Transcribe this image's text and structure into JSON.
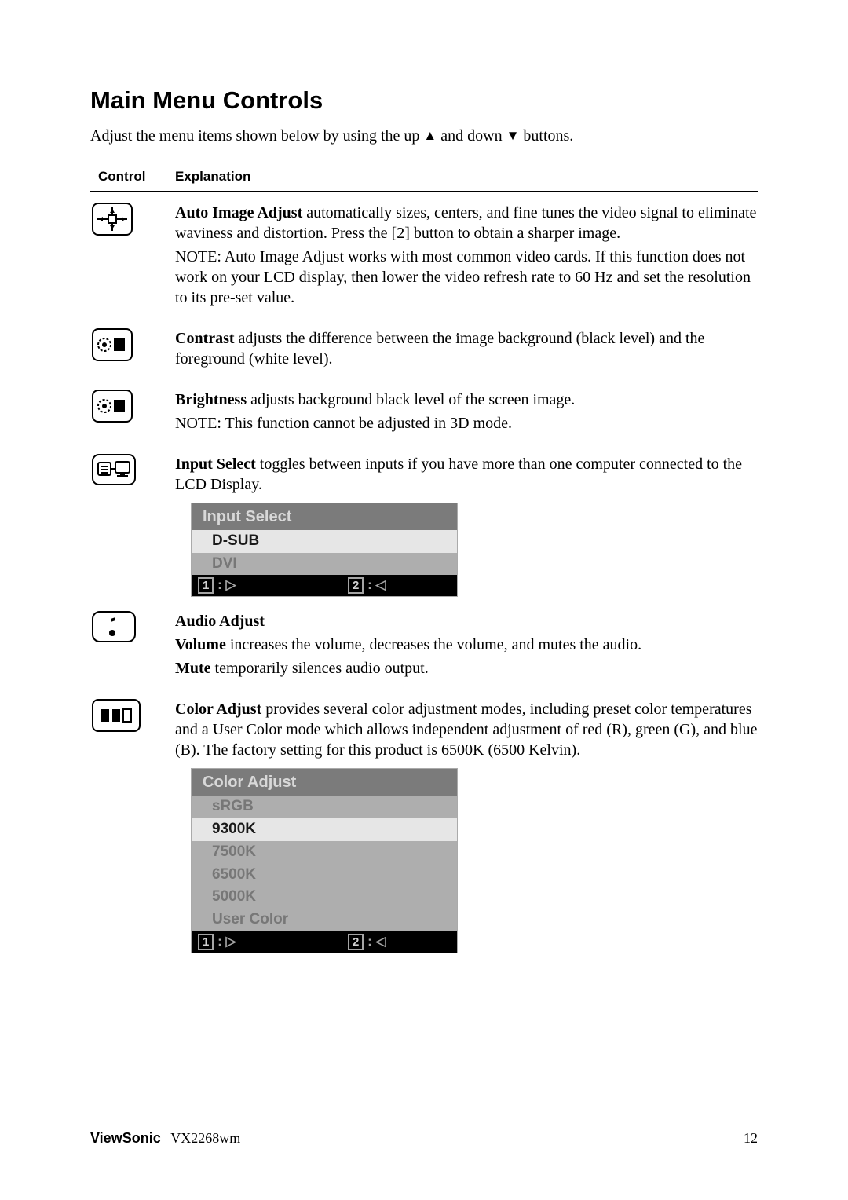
{
  "title": "Main Menu Controls",
  "intro_prefix": "Adjust the menu items shown below by using the up ",
  "intro_mid": " and down ",
  "intro_suffix": " buttons.",
  "table": {
    "col1": "Control",
    "col2": "Explanation"
  },
  "rows": {
    "auto_image": {
      "lead": "Auto Image Adjust",
      "body": " automatically sizes, centers, and fine tunes the video signal to eliminate waviness and distortion. Press the [2] button to obtain a sharper image.",
      "note_label": "NOTE:",
      "note": " Auto Image Adjust works with most common video cards. If this function does not work on your LCD display, then lower the video refresh rate to 60 Hz and set the resolution to its pre-set value."
    },
    "contrast": {
      "lead": "Contrast",
      "body": " adjusts the difference between the image background  (black level) and the foreground (white level)."
    },
    "brightness": {
      "lead": "Brightness",
      "body": " adjusts background black level of the screen image.",
      "note_label": "NOTE:",
      "note": " This function cannot be adjusted in 3D mode."
    },
    "input_select": {
      "lead": "Input Select",
      "body": " toggles between inputs if you have more than one computer connected to the LCD Display."
    },
    "audio": {
      "lead": "Audio Adjust",
      "vol_lead": "Volume",
      "vol_body": " increases the volume, decreases the volume, and mutes the audio.",
      "mute_lead": "Mute",
      "mute_body": " temporarily silences audio output."
    },
    "color": {
      "lead": "Color Adjust",
      "body": " provides several color adjustment modes, including preset color temperatures and a User Color mode which allows independent adjustment of red (R), green (G), and blue (B). The factory setting for this product is 6500K (6500 Kelvin)."
    }
  },
  "input_menu": {
    "title": "Input Select",
    "items": [
      "D-SUB",
      "DVI"
    ],
    "selected": 0,
    "footer_key1": "1",
    "footer_key2": "2"
  },
  "color_menu": {
    "title": "Color Adjust",
    "items": [
      "sRGB",
      "9300K",
      "7500K",
      "6500K",
      "5000K",
      "User Color"
    ],
    "selected": 1,
    "footer_key1": "1",
    "footer_key2": "2"
  },
  "footer": {
    "brand": "ViewSonic",
    "model": "VX2268wm",
    "page": "12"
  }
}
